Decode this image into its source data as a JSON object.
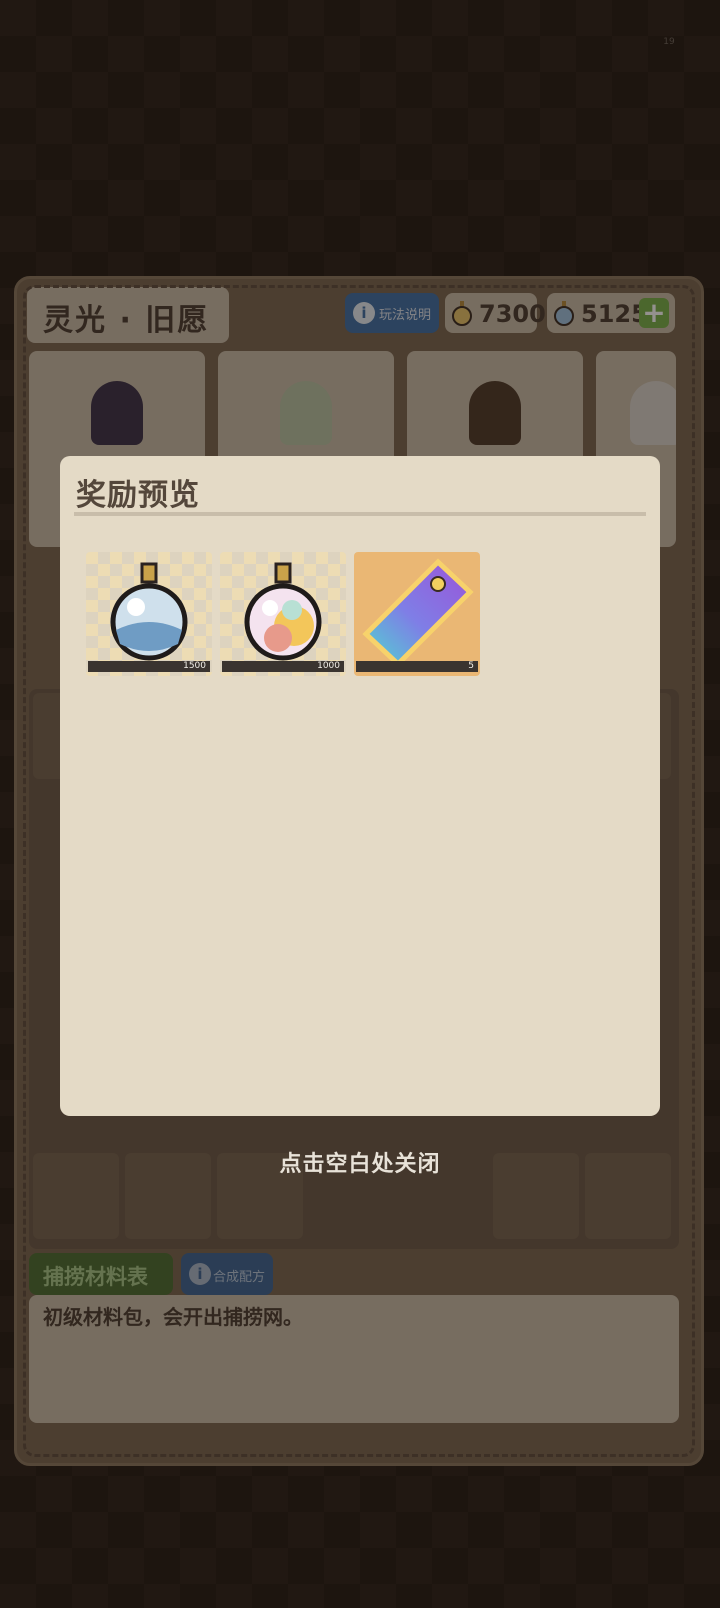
{
  "status_indicator": "19",
  "panel": {
    "title": "灵光 · 旧愿",
    "help_label": "玩法说明",
    "currencies": [
      {
        "icon": "gold-flask-icon",
        "amount": "7300"
      },
      {
        "icon": "blue-flask-icon",
        "amount": "5125"
      }
    ],
    "add_label": "+",
    "materials_tab_label": "捕捞材料表",
    "recipe_label": "合成配方",
    "description": "初级材料包，会开出捕捞网。"
  },
  "modal": {
    "title": "奖励预览",
    "rewards": [
      {
        "icon": "blue-potion-flask-icon",
        "quantity": "1500"
      },
      {
        "icon": "rainbow-potion-flask-icon",
        "quantity": "1000"
      },
      {
        "icon": "purple-ticket-icon",
        "quantity": "5"
      }
    ]
  },
  "close_hint": "点击空白处关闭",
  "colors": {
    "background": "#2b2119",
    "panel": "#7a6651",
    "modal": "#e4dac6",
    "accent_green": "#79b24a",
    "accent_blue": "#3f6fa6"
  }
}
